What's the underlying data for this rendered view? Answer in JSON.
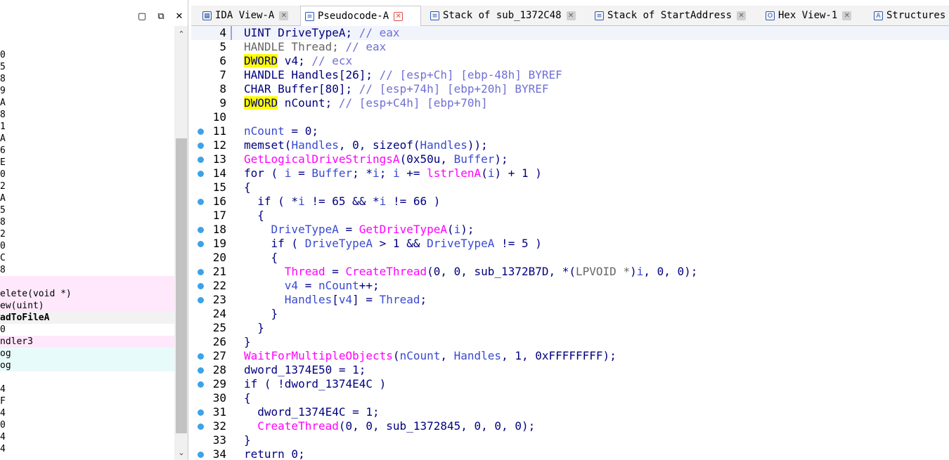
{
  "left_pane": {
    "rows": [
      "0",
      "5",
      "8",
      "9",
      "A",
      "8",
      "1",
      "A",
      "6",
      "E",
      "0",
      "2",
      "A",
      "5",
      "8",
      "2",
      "0",
      "C",
      "8",
      "",
      "elete(void *)",
      "ew(uint)",
      "adToFileA",
      "0",
      "ndler3",
      "og",
      "og",
      "",
      "4",
      "F",
      "4",
      "0",
      "4",
      "4"
    ]
  },
  "tabs": [
    {
      "label": "IDA View-A",
      "icon": "graph-icon"
    },
    {
      "label": "Pseudocode-A",
      "icon": "pseudocode-icon"
    },
    {
      "label": "Stack of sub_1372C48",
      "icon": "stack-icon"
    },
    {
      "label": "Stack of StartAddress",
      "icon": "stack-icon"
    },
    {
      "label": "Hex View-1",
      "icon": "hex-icon"
    },
    {
      "label": "Structures",
      "icon": "struct-icon"
    }
  ],
  "code": {
    "lines": [
      {
        "n": "4",
        "bp": false,
        "tokens": [
          [
            "kw",
            "UINT DriveTypeA; "
          ],
          [
            "cmt",
            "// eax"
          ]
        ]
      },
      {
        "n": "5",
        "bp": false,
        "tokens": [
          [
            "type",
            "HANDLE Thread; "
          ],
          [
            "cmt",
            "// eax"
          ]
        ]
      },
      {
        "n": "6",
        "bp": false,
        "tokens": [
          [
            "hl",
            "DWORD"
          ],
          [
            "kw",
            " v4; "
          ],
          [
            "cmt",
            "// ecx"
          ]
        ]
      },
      {
        "n": "7",
        "bp": false,
        "tokens": [
          [
            "kw",
            "HANDLE Handles[26]; "
          ],
          [
            "cmt",
            "// [esp+Ch] [ebp-48h] BYREF"
          ]
        ]
      },
      {
        "n": "8",
        "bp": false,
        "tokens": [
          [
            "kw",
            "CHAR Buffer[80]; "
          ],
          [
            "cmt",
            "// [esp+74h] [ebp+20h] BYREF"
          ]
        ]
      },
      {
        "n": "9",
        "bp": false,
        "tokens": [
          [
            "hl",
            "DWORD"
          ],
          [
            "kw",
            " nCount; "
          ],
          [
            "cmt",
            "// [esp+C4h] [ebp+70h]"
          ]
        ]
      },
      {
        "n": "10",
        "bp": false,
        "tokens": []
      },
      {
        "n": "11",
        "bp": true,
        "tokens": [
          [
            "var",
            "nCount"
          ],
          [
            "op",
            " = 0;"
          ]
        ]
      },
      {
        "n": "12",
        "bp": true,
        "tokens": [
          [
            "kw",
            "memset("
          ],
          [
            "var",
            "Handles"
          ],
          [
            "kw",
            ", 0, sizeof("
          ],
          [
            "var",
            "Handles"
          ],
          [
            "kw",
            "));"
          ]
        ]
      },
      {
        "n": "13",
        "bp": true,
        "tokens": [
          [
            "fn",
            "GetLogicalDriveStringsA"
          ],
          [
            "kw",
            "(0x50u, "
          ],
          [
            "var",
            "Buffer"
          ],
          [
            "kw",
            ");"
          ]
        ]
      },
      {
        "n": "14",
        "bp": true,
        "tokens": [
          [
            "kw",
            "for ( "
          ],
          [
            "var",
            "i"
          ],
          [
            "kw",
            " = "
          ],
          [
            "var",
            "Buffer"
          ],
          [
            "kw",
            "; *"
          ],
          [
            "var",
            "i"
          ],
          [
            "kw",
            "; "
          ],
          [
            "var",
            "i"
          ],
          [
            "kw",
            " += "
          ],
          [
            "fn",
            "lstrlenA"
          ],
          [
            "kw",
            "("
          ],
          [
            "var",
            "i"
          ],
          [
            "kw",
            ") + 1 )"
          ]
        ]
      },
      {
        "n": "15",
        "bp": false,
        "tokens": [
          [
            "kw",
            "{"
          ]
        ]
      },
      {
        "n": "16",
        "bp": true,
        "tokens": [
          [
            "kw",
            "  if ( *"
          ],
          [
            "var",
            "i"
          ],
          [
            "kw",
            " != 65 && *"
          ],
          [
            "var",
            "i"
          ],
          [
            "kw",
            " != 66 )"
          ]
        ]
      },
      {
        "n": "17",
        "bp": false,
        "tokens": [
          [
            "kw",
            "  {"
          ]
        ]
      },
      {
        "n": "18",
        "bp": true,
        "tokens": [
          [
            "var",
            "    DriveTypeA"
          ],
          [
            "kw",
            " = "
          ],
          [
            "fn",
            "GetDriveTypeA"
          ],
          [
            "kw",
            "("
          ],
          [
            "var",
            "i"
          ],
          [
            "kw",
            ");"
          ]
        ]
      },
      {
        "n": "19",
        "bp": true,
        "tokens": [
          [
            "kw",
            "    if ( "
          ],
          [
            "var",
            "DriveTypeA"
          ],
          [
            "kw",
            " > 1 && "
          ],
          [
            "var",
            "DriveTypeA"
          ],
          [
            "kw",
            " != 5 )"
          ]
        ]
      },
      {
        "n": "20",
        "bp": false,
        "tokens": [
          [
            "kw",
            "    {"
          ]
        ]
      },
      {
        "n": "21",
        "bp": true,
        "tokens": [
          [
            "fn",
            "      Thread"
          ],
          [
            "kw",
            " = "
          ],
          [
            "fn",
            "CreateThread"
          ],
          [
            "kw",
            "(0, 0, sub_1372B7D, *("
          ],
          [
            "type",
            "LPVOID *"
          ],
          [
            "kw",
            ")"
          ],
          [
            "var",
            "i"
          ],
          [
            "kw",
            ", 0, 0);"
          ]
        ]
      },
      {
        "n": "22",
        "bp": true,
        "tokens": [
          [
            "var",
            "      v4"
          ],
          [
            "kw",
            " = "
          ],
          [
            "var",
            "nCount"
          ],
          [
            "kw",
            "++;"
          ]
        ]
      },
      {
        "n": "23",
        "bp": true,
        "tokens": [
          [
            "var",
            "      Handles"
          ],
          [
            "kw",
            "["
          ],
          [
            "var",
            "v4"
          ],
          [
            "kw",
            "] = "
          ],
          [
            "var",
            "Thread"
          ],
          [
            "kw",
            ";"
          ]
        ]
      },
      {
        "n": "24",
        "bp": false,
        "tokens": [
          [
            "kw",
            "    }"
          ]
        ]
      },
      {
        "n": "25",
        "bp": false,
        "tokens": [
          [
            "kw",
            "  }"
          ]
        ]
      },
      {
        "n": "26",
        "bp": false,
        "tokens": [
          [
            "kw",
            "}"
          ]
        ]
      },
      {
        "n": "27",
        "bp": true,
        "tokens": [
          [
            "fn",
            "WaitForMultipleObjects"
          ],
          [
            "kw",
            "("
          ],
          [
            "var",
            "nCount"
          ],
          [
            "kw",
            ", "
          ],
          [
            "var",
            "Handles"
          ],
          [
            "kw",
            ", 1, 0xFFFFFFFF);"
          ]
        ]
      },
      {
        "n": "28",
        "bp": true,
        "tokens": [
          [
            "kw",
            "dword_1374E50 = 1;"
          ]
        ]
      },
      {
        "n": "29",
        "bp": true,
        "tokens": [
          [
            "kw",
            "if ( !dword_1374E4C )"
          ]
        ]
      },
      {
        "n": "30",
        "bp": false,
        "tokens": [
          [
            "kw",
            "{"
          ]
        ]
      },
      {
        "n": "31",
        "bp": true,
        "tokens": [
          [
            "kw",
            "  dword_1374E4C = 1;"
          ]
        ]
      },
      {
        "n": "32",
        "bp": true,
        "tokens": [
          [
            "fn",
            "  CreateThread"
          ],
          [
            "kw",
            "(0, 0, sub_1372845, 0, 0, 0);"
          ]
        ]
      },
      {
        "n": "33",
        "bp": false,
        "tokens": [
          [
            "kw",
            "}"
          ]
        ]
      },
      {
        "n": "34",
        "bp": true,
        "tokens": [
          [
            "kw",
            "return 0;"
          ]
        ]
      }
    ]
  },
  "colors": {
    "pink_row": "#ffe8fb",
    "cyan_row": "#e8fbfb",
    "sel_row": "#f2f2f2",
    "breakpoint": "#3da2e8",
    "highlight": "#ffff00"
  }
}
